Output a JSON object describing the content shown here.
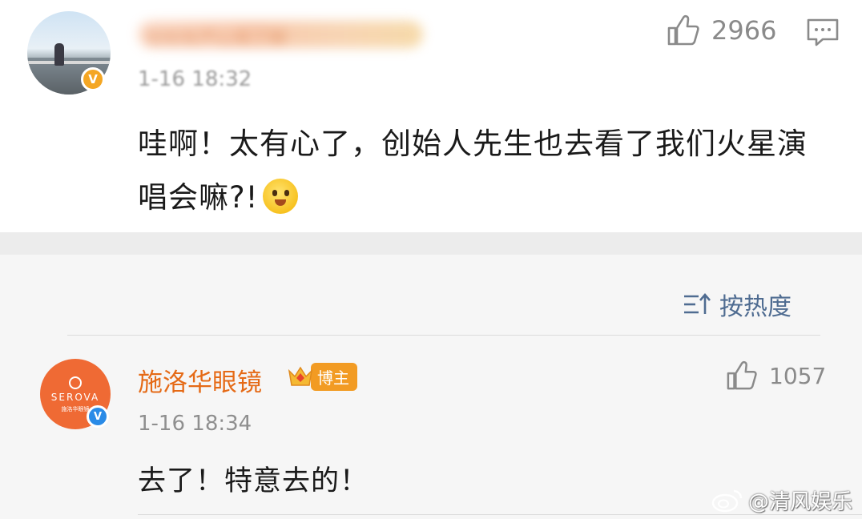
{
  "top_comment": {
    "username": "知知有芦心有了解",
    "time": "1-16 18:32",
    "text": "哇啊！太有心了，创始人先生也去看了我们火星演唱会嘛?!",
    "like_count": "2966",
    "verified_color": "#f4a623"
  },
  "sort": {
    "label": "按热度"
  },
  "reply": {
    "username": "施洛华眼镜",
    "badge_label": "博主",
    "avatar_logo": "SEROVA",
    "avatar_sub": "施洛华眼镜",
    "time": "1-16 18:34",
    "text": "去了！特意去的！",
    "like_count": "1057",
    "name_color": "#e56a16",
    "verified_color": "#2a8be7"
  },
  "watermark": {
    "text": "@清风娱乐"
  }
}
